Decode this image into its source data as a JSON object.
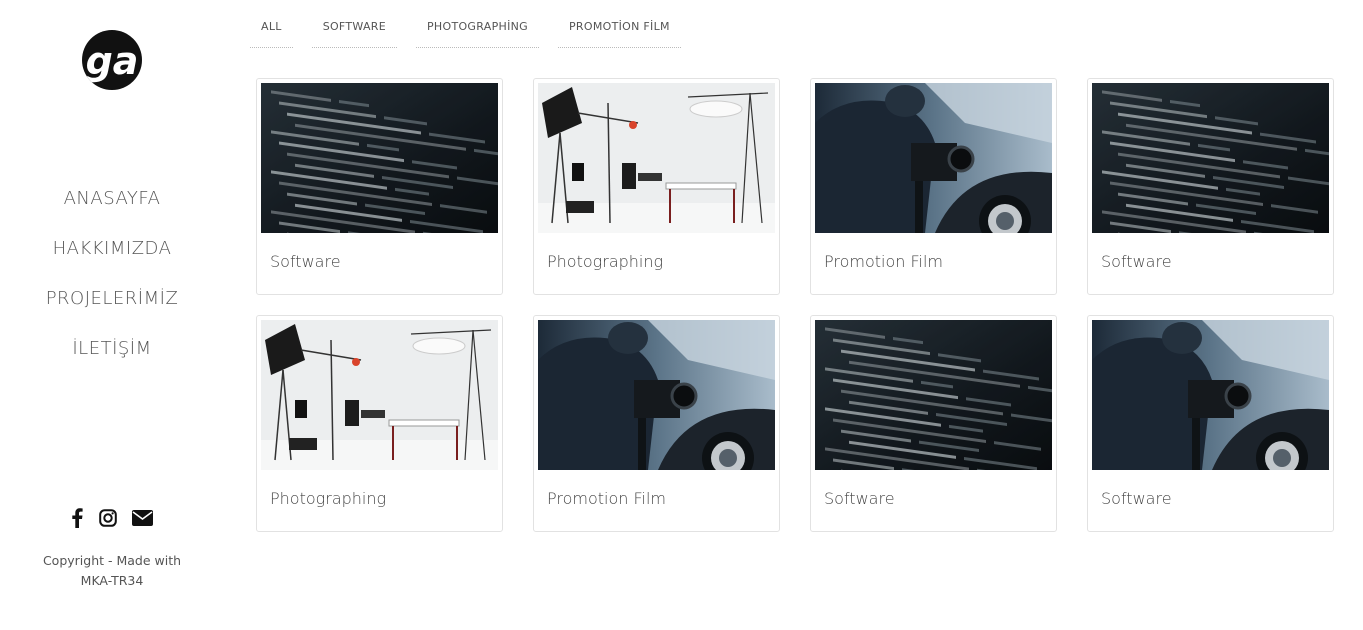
{
  "brand": {
    "logo_text": "ga"
  },
  "nav": {
    "items": [
      {
        "label": "ANASAYFA"
      },
      {
        "label": "HAKKIMIZDA"
      },
      {
        "label": "PROJELERİMİZ"
      },
      {
        "label": "İLETİŞİM"
      }
    ]
  },
  "social": {
    "icons": [
      "facebook-icon",
      "instagram-icon",
      "envelope-icon"
    ]
  },
  "footer": {
    "copyright_line1": "Copyright - Made with",
    "copyright_line2": "MKA-TR34"
  },
  "filters": [
    {
      "label": "ALL"
    },
    {
      "label": "SOFTWARE"
    },
    {
      "label": "PHOTOGRAPHİNG"
    },
    {
      "label": "PROMOTİON FİLM"
    }
  ],
  "portfolio": [
    {
      "title": "Software",
      "image": "code-screen"
    },
    {
      "title": "Photographing",
      "image": "photo-studio"
    },
    {
      "title": "Promotion Film",
      "image": "film-camera"
    },
    {
      "title": "Software",
      "image": "code-screen"
    },
    {
      "title": "Photographing",
      "image": "photo-studio"
    },
    {
      "title": "Promotion Film",
      "image": "film-camera"
    },
    {
      "title": "Software",
      "image": "code-screen"
    },
    {
      "title": "Software",
      "image": "film-camera"
    }
  ],
  "colors": {
    "text": "#444444",
    "card_border": "#e2e2e2",
    "logo_bg": "#111111"
  }
}
